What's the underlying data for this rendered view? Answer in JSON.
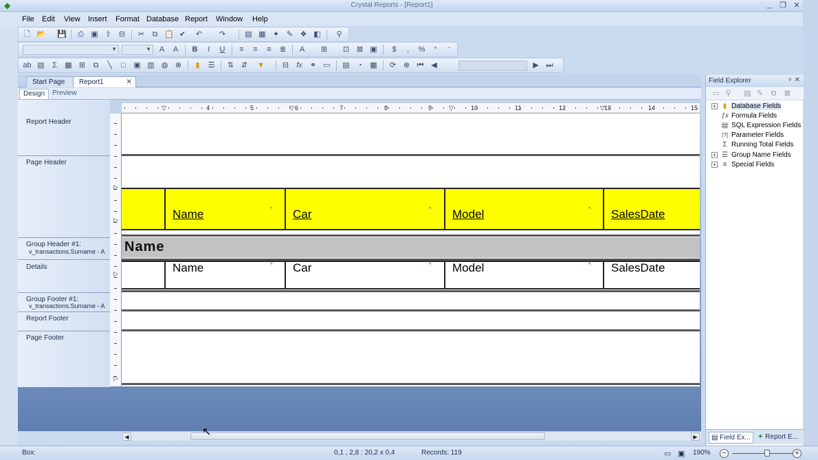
{
  "app": {
    "title": "Crystal Reports - [Report1]",
    "minimize": "_",
    "maximize": "❐",
    "close": "✕"
  },
  "menu": [
    "File",
    "Edit",
    "View",
    "Insert",
    "Format",
    "Database",
    "Report",
    "Window",
    "Help"
  ],
  "doc_tabs": {
    "start": "Start Page",
    "report": "Report1",
    "close": "✕"
  },
  "view_tabs": {
    "design": "Design",
    "preview": "Preview"
  },
  "sections": {
    "report_header": "Report Header",
    "page_header": "Page Header",
    "group_header_1": "Group Header #1:",
    "group_header_2": "v_transactions.Surname - A",
    "details": "Details",
    "group_footer_1": "Group Footer #1:",
    "group_footer_2": "v_transactions.Surname - A",
    "report_footer": "Report Footer",
    "page_footer": "Page Footer"
  },
  "ruler": [
    "4",
    "5",
    "6",
    "7",
    "8",
    "9",
    "10",
    "11",
    "12",
    "13",
    "14",
    "15"
  ],
  "header_fields": [
    "Name",
    "Car",
    "Model",
    "SalesDate"
  ],
  "group_field": "Name",
  "detail_fields": [
    "Name",
    "Car",
    "Model",
    "SalesDate"
  ],
  "field_explorer": {
    "title": "Field Explorer",
    "pin": "ᵖ",
    "close": "✕",
    "items": [
      {
        "label": "Database Fields",
        "expand": "+",
        "icon": "▮"
      },
      {
        "label": "Formula Fields",
        "expand": "",
        "icon": "ƒx"
      },
      {
        "label": "SQL Expression Fields",
        "expand": "",
        "icon": "▤"
      },
      {
        "label": "Parameter Fields",
        "expand": "",
        "icon": "[?]"
      },
      {
        "label": "Running Total Fields",
        "expand": "",
        "icon": "Σ"
      },
      {
        "label": "Group Name Fields",
        "expand": "+",
        "icon": "☰"
      },
      {
        "label": "Special Fields",
        "expand": "+",
        "icon": "≡"
      }
    ],
    "bottom_tabs": [
      "Field Ex...",
      "Report E..."
    ]
  },
  "status": {
    "left": "Box:",
    "coords": "0,1 , 2,8 : 20,2 x 0,4",
    "records": "Records:  119",
    "zoom": "190%",
    "zoom_out": "−",
    "zoom_in": "+"
  }
}
